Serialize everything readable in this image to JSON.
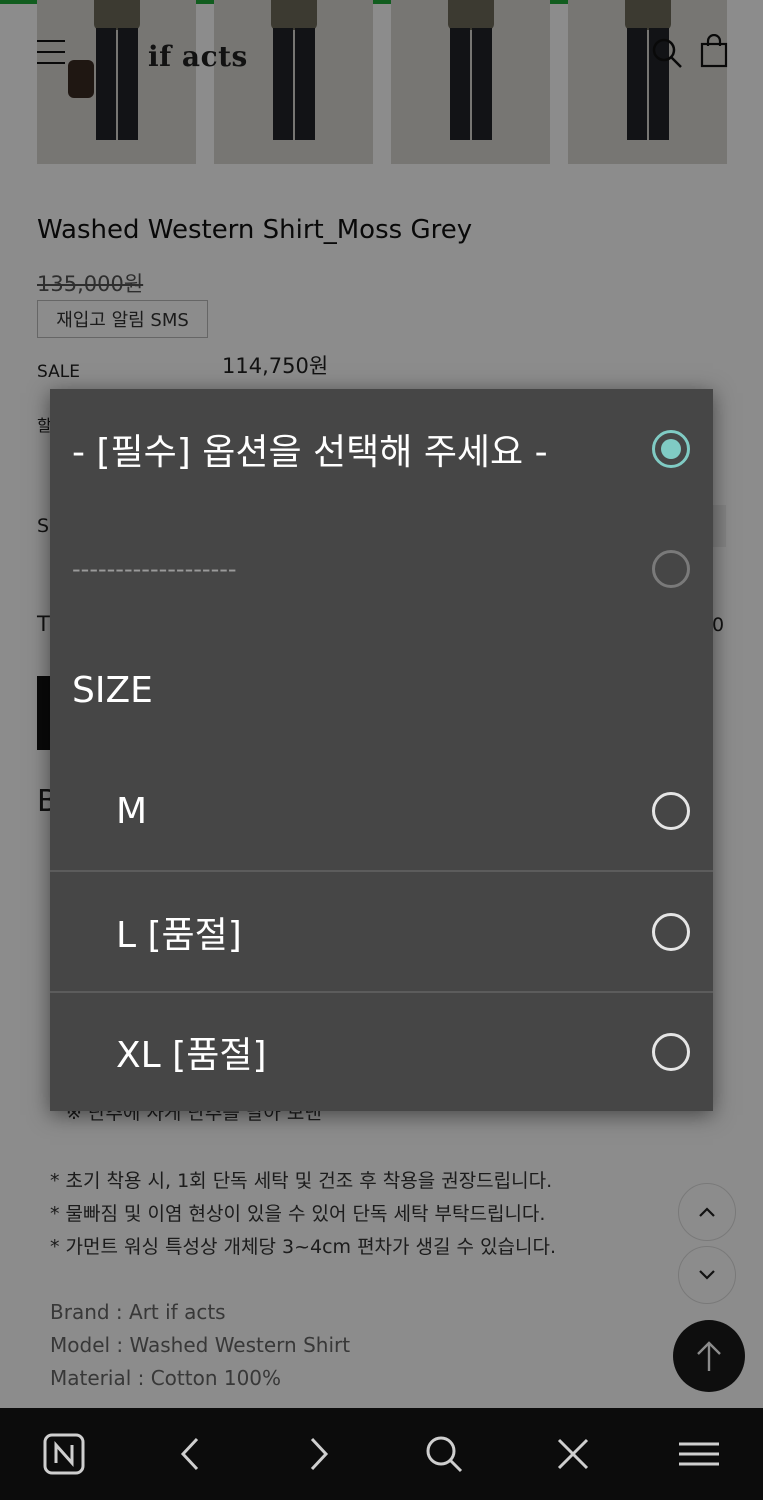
{
  "header": {
    "logo": "if acts"
  },
  "product": {
    "title": "Washed Western Shirt_Moss Grey",
    "original_price": "135,000원",
    "restock_sms_label": "재입고 알림 SMS",
    "sale_label": "SALE",
    "sale_price": "114,750원"
  },
  "background_fragments": {
    "frag_a": "할",
    "frag_b": "S",
    "frag_c": "T",
    "frag_d": "0",
    "frag_e": "B"
  },
  "description": {
    "top_partial": "※ 단추에 사게 단추를 달아 보낸",
    "lines": [
      "* 초기 착용 시, 1회 단독 세탁 및 건조 후 착용을 권장드립니다.",
      "* 물빠짐 및 이염 현상이 있을 수 있어 단독 세탁 부탁드립니다.",
      "* 가먼트 워싱 특성상 개체당 3~4cm 편차가 생길 수 있습니다."
    ],
    "brand": "Brand : Art if acts",
    "model": "Model : Washed Western Shirt",
    "material": "Material : Cotton 100%"
  },
  "dialog": {
    "placeholder": "- [필수] 옵션을 선택해 주세요 -",
    "separator": "-------------------",
    "size_header": "SIZE",
    "options": [
      "M",
      "L [품절]",
      "XL [품절]"
    ],
    "selected": "- [필수] 옵션을 선택해 주세요 -",
    "accent_color": "#80cbc4",
    "background_color": "#464646"
  },
  "toolbar": {
    "icons": [
      "naver-n-icon",
      "back-arrow-icon",
      "forward-arrow-icon",
      "search-icon",
      "close-icon",
      "hamburger-menu-icon"
    ]
  },
  "colors": {
    "progress": "#1faa3a",
    "toolbar_bg": "#0c0c0c"
  }
}
